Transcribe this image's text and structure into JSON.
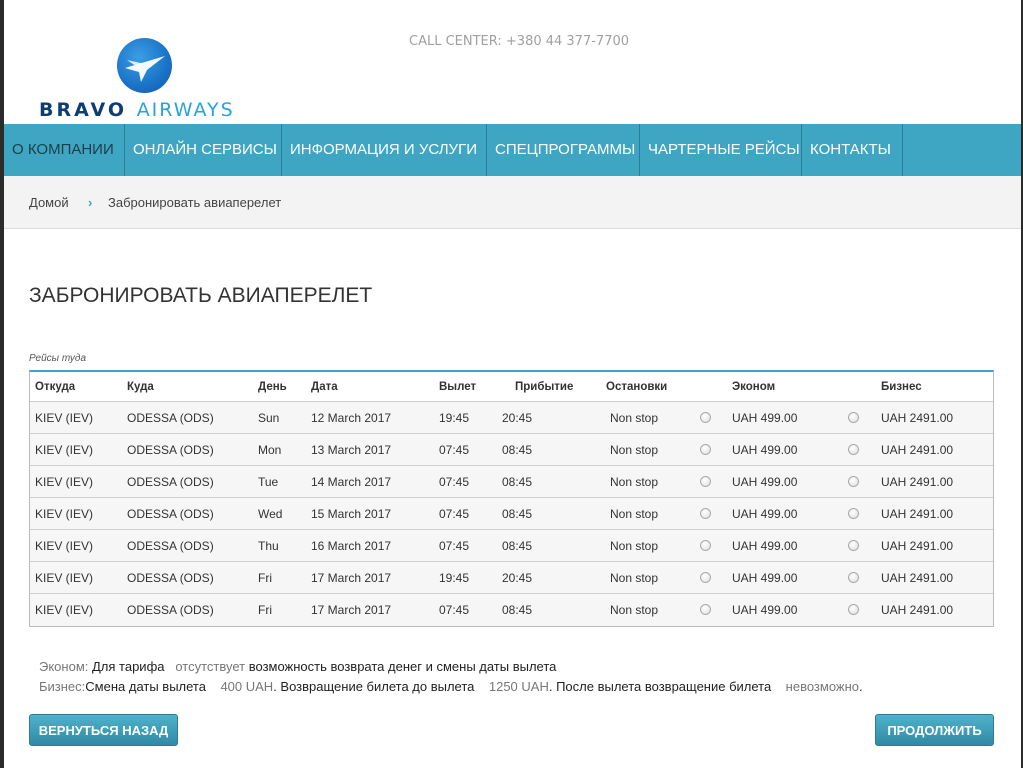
{
  "header": {
    "logo_word1": "BRAVO",
    "logo_word2": "AIRWAYS",
    "call_center": "CALL CENTER: +380 44 377-7700"
  },
  "nav": {
    "items": [
      "О КОМПАНИИ",
      "ОНЛАЙН СЕРВИСЫ",
      "ИНФОРМАЦИЯ И УСЛУГИ",
      "СПЕЦПРОГРАММЫ",
      "ЧАРТЕРНЫЕ РЕЙСЫ",
      "КОНТАКТЫ"
    ]
  },
  "breadcrumb": {
    "home": "Домой",
    "separator": "›",
    "current": "Забронировать авиаперелет"
  },
  "page": {
    "title": "ЗАБРОНИРОВАТЬ АВИАПЕРЕЛЕТ",
    "section_caption": "Рейсы туда"
  },
  "table": {
    "headers": {
      "from": "Откуда",
      "to": "Куда",
      "day": "День",
      "date": "Дата",
      "departure": "Вылет",
      "arrival": "Прибытие",
      "stops": "Остановки",
      "economy": "Эконом",
      "business": "Бизнес"
    },
    "rows": [
      {
        "from": "KIEV (IEV)",
        "to": "ODESSA (ODS)",
        "day": "Sun",
        "date": "12 March 2017",
        "departure": "19:45",
        "arrival": "20:45",
        "stops": "Non stop",
        "economy": "UAH 499.00",
        "business": "UAH 2491.00"
      },
      {
        "from": "KIEV (IEV)",
        "to": "ODESSA (ODS)",
        "day": "Mon",
        "date": "13 March 2017",
        "departure": "07:45",
        "arrival": "08:45",
        "stops": "Non stop",
        "economy": "UAH 499.00",
        "business": "UAH 2491.00"
      },
      {
        "from": "KIEV (IEV)",
        "to": "ODESSA (ODS)",
        "day": "Tue",
        "date": "14 March 2017",
        "departure": "07:45",
        "arrival": "08:45",
        "stops": "Non stop",
        "economy": "UAH 499.00",
        "business": "UAH 2491.00"
      },
      {
        "from": "KIEV (IEV)",
        "to": "ODESSA (ODS)",
        "day": "Wed",
        "date": "15 March 2017",
        "departure": "07:45",
        "arrival": "08:45",
        "stops": "Non stop",
        "economy": "UAH 499.00",
        "business": "UAH 2491.00"
      },
      {
        "from": "KIEV (IEV)",
        "to": "ODESSA (ODS)",
        "day": "Thu",
        "date": "16 March 2017",
        "departure": "07:45",
        "arrival": "08:45",
        "stops": "Non stop",
        "economy": "UAH 499.00",
        "business": "UAH 2491.00"
      },
      {
        "from": "KIEV (IEV)",
        "to": "ODESSA (ODS)",
        "day": "Fri",
        "date": "17 March 2017",
        "departure": "19:45",
        "arrival": "20:45",
        "stops": "Non stop",
        "economy": "UAH 499.00",
        "business": "UAH 2491.00"
      },
      {
        "from": "KIEV (IEV)",
        "to": "ODESSA (ODS)",
        "day": "Fri",
        "date": "17 March 2017",
        "departure": "07:45",
        "arrival": "08:45",
        "stops": "Non stop",
        "economy": "UAH 499.00",
        "business": "UAH 2491.00"
      }
    ]
  },
  "notes": {
    "economy_label": "Эконом:",
    "economy_text1": "Для тарифа",
    "economy_muted": "отсутствует",
    "economy_text2": "возможность возврата денег и смены даты вылета",
    "business_label": "Бизнес:",
    "business_text1": "Смена даты вылета",
    "business_muted1": "400 UAH",
    "business_text2": ". Возвращение билета до вылета",
    "business_muted2": "1250 UAH",
    "business_text3": ". После вылета возвращение билета",
    "business_muted3": "невозможно",
    "business_text4": "."
  },
  "buttons": {
    "back": "ВЕРНУТЬСЯ НАЗАД",
    "next": "ПРОДОЛЖИТЬ"
  },
  "colors": {
    "nav_bg": "#3ea6c2",
    "logo_dark": "#0c3d73",
    "logo_light": "#27a3e0"
  },
  "icons": {
    "logo": "plane-logo-icon",
    "radio": "radio-icon",
    "breadcrumb_separator": "chevron-right-icon"
  }
}
